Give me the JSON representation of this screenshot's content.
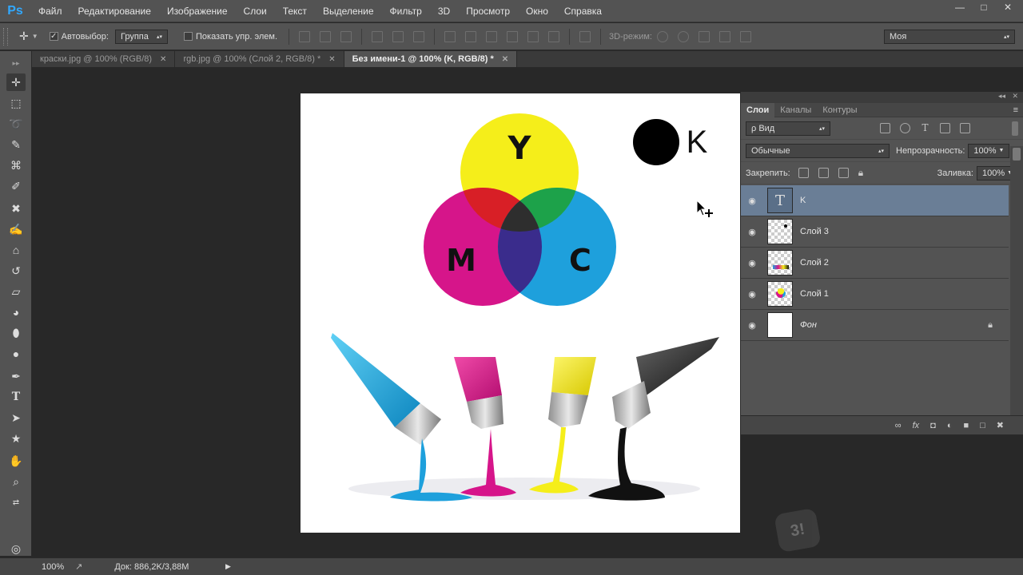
{
  "menu": {
    "logo": "Ps",
    "items": [
      "Файл",
      "Редактирование",
      "Изображение",
      "Слои",
      "Текст",
      "Выделение",
      "Фильтр",
      "3D",
      "Просмотр",
      "Окно",
      "Справка"
    ]
  },
  "options": {
    "autoselect_label": "Автовыбор:",
    "autoselect_value": "Группа",
    "show_controls_label": "Показать упр. элем.",
    "mode3d_label": "3D-режим:",
    "workspace_value": "Моя"
  },
  "tabs": [
    {
      "label": "краски.jpg @ 100% (RGB/8)",
      "active": false
    },
    {
      "label": "rgb.jpg @ 100% (Слой 2, RGB/8) *",
      "active": false
    },
    {
      "label": "Без имени-1 @ 100% (K, RGB/8) *",
      "active": true
    }
  ],
  "canvas": {
    "letters": {
      "y": "Y",
      "m": "M",
      "c": "C",
      "k": "K"
    },
    "colors": {
      "cyan": "#1ea0dc",
      "magenta": "#d6158a",
      "yellow": "#f5ee1a",
      "black": "#111111"
    }
  },
  "layers_panel": {
    "tabs": [
      "Слои",
      "Каналы",
      "Контуры"
    ],
    "filter_value": "ρ Вид",
    "blend_mode": "Обычные",
    "opacity_label": "Непрозрачность:",
    "opacity_value": "100%",
    "lock_label": "Закрепить:",
    "fill_label": "Заливка:",
    "fill_value": "100%",
    "layers": [
      {
        "name": "K",
        "type": "text",
        "selected": true
      },
      {
        "name": "Слой 3",
        "type": "pixel",
        "selected": false
      },
      {
        "name": "Слой 2",
        "type": "pixel",
        "selected": false
      },
      {
        "name": "Слой 1",
        "type": "pixel",
        "selected": false
      },
      {
        "name": "Фон",
        "type": "background",
        "selected": false,
        "locked": true
      }
    ]
  },
  "status": {
    "zoom": "100%",
    "doc": "Док: 886,2K/3,88M"
  }
}
